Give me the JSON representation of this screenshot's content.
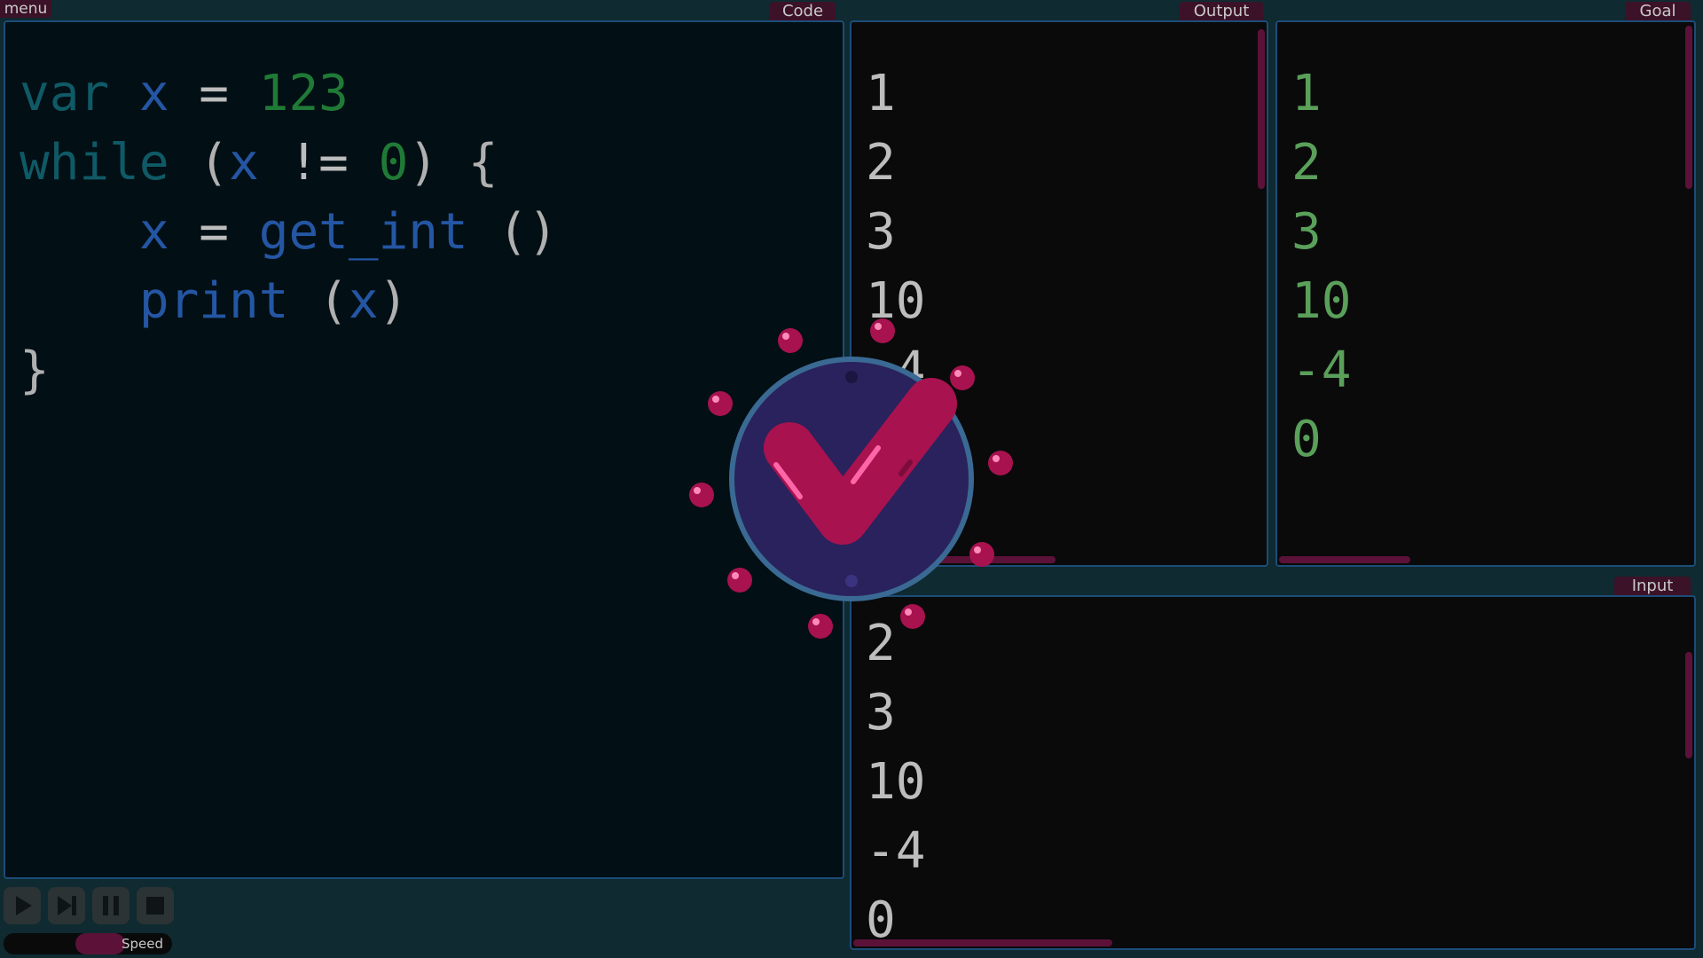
{
  "menu": {
    "label": "menu"
  },
  "code_panel": {
    "tab": "Code",
    "lines": [
      [
        {
          "t": "var ",
          "c": "kw"
        },
        {
          "t": "x",
          "c": "id"
        },
        {
          "t": " = ",
          "c": "op"
        },
        {
          "t": "123",
          "c": "lit"
        }
      ],
      [
        {
          "t": "while ",
          "c": "kw"
        },
        {
          "t": "(",
          "c": "punc"
        },
        {
          "t": "x",
          "c": "id"
        },
        {
          "t": " != ",
          "c": "op"
        },
        {
          "t": "0",
          "c": "lit"
        },
        {
          "t": ") {",
          "c": "punc"
        }
      ],
      [
        {
          "t": "    ",
          "c": "op"
        },
        {
          "t": "x",
          "c": "id"
        },
        {
          "t": " = ",
          "c": "op"
        },
        {
          "t": "get_int",
          "c": "id"
        },
        {
          "t": " ()",
          "c": "punc"
        }
      ],
      [
        {
          "t": "    ",
          "c": "op"
        },
        {
          "t": "print",
          "c": "id"
        },
        {
          "t": " (",
          "c": "punc"
        },
        {
          "t": "x",
          "c": "id"
        },
        {
          "t": ")",
          "c": "punc"
        }
      ],
      [
        {
          "t": "}",
          "c": "punc"
        }
      ]
    ]
  },
  "output_panel": {
    "tab": "Output",
    "values": [
      "1",
      "2",
      "3",
      "10",
      "-4"
    ]
  },
  "goal_panel": {
    "tab": "Goal",
    "values": [
      "1",
      "2",
      "3",
      "10",
      "-4",
      "0"
    ]
  },
  "input_panel": {
    "tab": "Input",
    "values": [
      "2",
      "3",
      "10",
      "-4",
      "0"
    ]
  },
  "controls": {
    "buttons": [
      {
        "name": "play-button",
        "icon": "play-icon"
      },
      {
        "name": "step-button",
        "icon": "step-forward-icon"
      },
      {
        "name": "pause-button",
        "icon": "pause-icon"
      },
      {
        "name": "stop-button",
        "icon": "stop-icon"
      }
    ],
    "speed_label": "Speed",
    "speed_value": 0.5
  },
  "success_overlay": {
    "icon": "checkmark-icon"
  },
  "colors": {
    "background": "#0f2a30",
    "accent": "#a8124f",
    "panel_border": "#1c4c78",
    "goal_text": "#5aa05a",
    "output_text": "#bdbdbd"
  }
}
